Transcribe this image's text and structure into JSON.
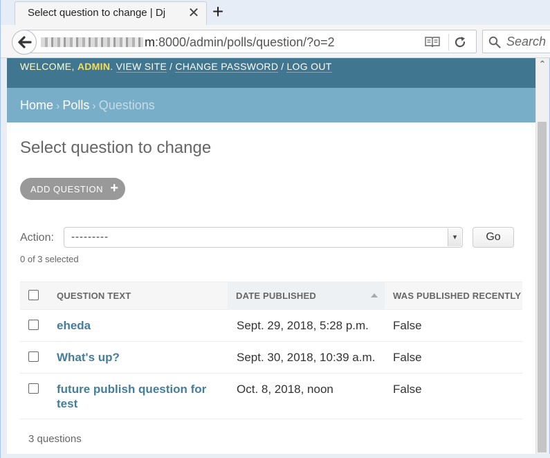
{
  "browser": {
    "tab_title": "Select question to change | Dj",
    "url_host_visible": "m",
    "url_rest": ":8000/admin/polls/question/?o=2",
    "search_placeholder": "Search"
  },
  "header": {
    "welcome": "WELCOME,",
    "user": "ADMIN",
    "view_site": "VIEW SITE",
    "change_password": "CHANGE PASSWORD",
    "log_out": "LOG OUT",
    "separator": "/"
  },
  "breadcrumbs": {
    "home": "Home",
    "app": "Polls",
    "current": "Questions",
    "arrow": "›"
  },
  "page_title": "Select question to change",
  "add_button": {
    "label": "ADD QUESTION",
    "icon": "+"
  },
  "actions": {
    "label": "Action:",
    "selected": "---------",
    "go_label": "Go",
    "counter": "0 of 3 selected"
  },
  "table": {
    "columns": [
      "QUESTION TEXT",
      "DATE PUBLISHED",
      "WAS PUBLISHED RECENTLY"
    ],
    "sorted_column": "DATE PUBLISHED",
    "sort_direction": "ascending",
    "rows": [
      {
        "question": "eheda",
        "date": "Sept. 29, 2018, 5:28 p.m.",
        "recent": "False"
      },
      {
        "question": "What's up?",
        "date": "Sept. 30, 2018, 10:39 a.m.",
        "recent": "False"
      },
      {
        "question_line1": "future publish question for",
        "question_line2": "test",
        "date": "Oct. 8, 2018, noon",
        "recent": "False"
      }
    ]
  },
  "total": "3 questions",
  "colors": {
    "header_bg": "#417690",
    "breadcrumb_bg": "#79aec8",
    "link": "#447e9b",
    "welcome_text": "#ffffcc"
  }
}
